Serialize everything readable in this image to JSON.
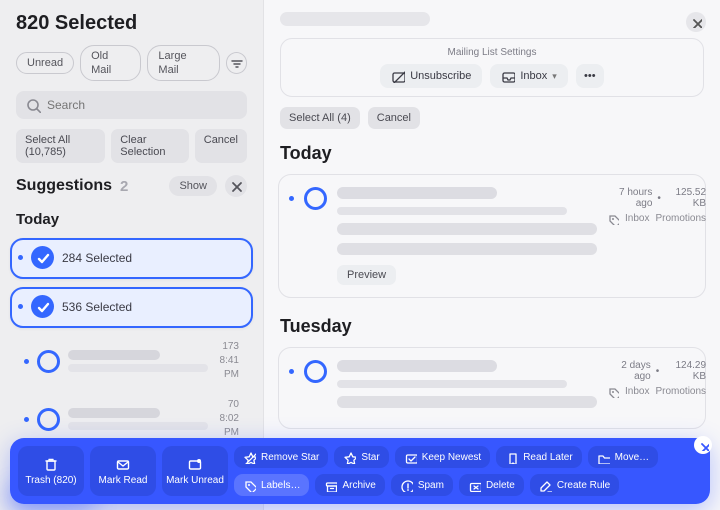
{
  "left": {
    "title": "820 Selected",
    "filters": [
      "Unread",
      "Old Mail",
      "Large Mail"
    ],
    "search_placeholder": "Search",
    "actions": {
      "select_all": "Select All (10,785)",
      "clear": "Clear Selection",
      "cancel": "Cancel"
    },
    "suggestions": {
      "title": "Suggestions",
      "count": "2",
      "show": "Show"
    },
    "day": "Today",
    "clusters": [
      {
        "selected_label": "284 Selected"
      },
      {
        "selected_label": "536 Selected"
      }
    ],
    "rows": [
      {
        "count": "173",
        "time": "8:41 PM"
      },
      {
        "count": "70",
        "time": "8:02 PM"
      }
    ]
  },
  "right": {
    "ml_title": "Mailing List Settings",
    "unsubscribe": "Unsubscribe",
    "inbox_menu": "Inbox",
    "chips": {
      "select_all": "Select All (4)",
      "cancel": "Cancel"
    },
    "groups": [
      {
        "day": "Today",
        "age": "7 hours ago",
        "size": "125.52 KB",
        "tag1": "Inbox",
        "tag2": "Promotions",
        "preview": "Preview"
      },
      {
        "day": "Tuesday",
        "age": "2 days ago",
        "size": "124.29 KB",
        "tag1": "Inbox",
        "tag2": "Promotions"
      }
    ]
  },
  "bar": {
    "big": [
      {
        "label": "Trash (820)",
        "icon": "trash"
      },
      {
        "label": "Mark Read",
        "icon": "read"
      },
      {
        "label": "Mark Unread",
        "icon": "unread"
      }
    ],
    "acts": [
      {
        "label": "Remove Star",
        "icon": "star-off"
      },
      {
        "label": "Star",
        "icon": "star"
      },
      {
        "label": "Keep Newest",
        "icon": "keep"
      },
      {
        "label": "Read Later",
        "icon": "bookmark"
      },
      {
        "label": "Move…",
        "icon": "folder"
      },
      {
        "label": "Labels…",
        "icon": "tag",
        "variant": "lab"
      },
      {
        "label": "Archive",
        "icon": "archive"
      },
      {
        "label": "Spam",
        "icon": "spam"
      },
      {
        "label": "Delete",
        "icon": "delete"
      },
      {
        "label": "Create Rule",
        "icon": "rule"
      }
    ]
  }
}
